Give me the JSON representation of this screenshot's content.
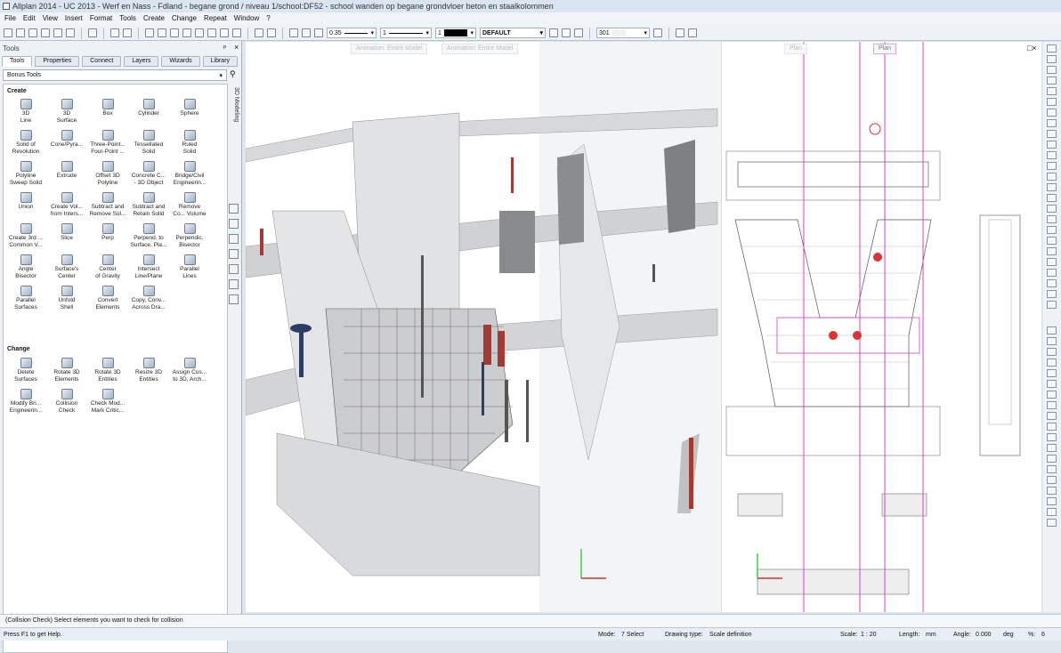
{
  "window": {
    "title": "Allplan 2014 - UC 2013 - Werf en Nass - Fdland - begane grond / niveau 1/school:DF52 - school wanden op begane grondvloer beton en staalkolommen"
  },
  "menu": [
    "File",
    "Edit",
    "View",
    "Insert",
    "Format",
    "Tools",
    "Create",
    "Change",
    "Repeat",
    "Window",
    "?"
  ],
  "toolbar": {
    "pen": "0.35",
    "line": "1",
    "color": "1",
    "layer": "DEFAULT",
    "format": "301"
  },
  "panel": {
    "title": "Tools",
    "pin": "ᵖ",
    "close": "×",
    "tabs": [
      "Tools",
      "Properties",
      "Connect",
      "Layers",
      "Wizards",
      "Library"
    ],
    "active_tab": "Tools",
    "palette": "Bonus Tools",
    "vertical_tab": "3D Modeling",
    "create_label": "Create",
    "create_tools": [
      [
        "3D",
        "Line"
      ],
      [
        "3D",
        "Surface"
      ],
      [
        "Box",
        ""
      ],
      [
        "Cylinder",
        ""
      ],
      [
        "Sphere",
        ""
      ],
      [
        "Solid of",
        "Revolution"
      ],
      [
        "Cone/Pyra...",
        ""
      ],
      [
        "Three-Point...",
        "Four-Point ..."
      ],
      [
        "Tessellated",
        "Solid"
      ],
      [
        "Ruled",
        "Solid"
      ],
      [
        "Polyline",
        "Sweep Solid"
      ],
      [
        "Extrude",
        ""
      ],
      [
        "Offset 3D",
        "Polyline"
      ],
      [
        "Concrete C...",
        "- 3D Object"
      ],
      [
        "Bridge/Civil",
        "Engineerin..."
      ],
      [
        "Union",
        ""
      ],
      [
        "Create Vol...",
        "from Inters..."
      ],
      [
        "Subtract and",
        "Remove Sol..."
      ],
      [
        "Subtract and",
        "Retain Solid"
      ],
      [
        "Remove",
        "Co... Volume"
      ],
      [
        "Create 3rd ...",
        "Common V..."
      ],
      [
        "Slice",
        ""
      ],
      [
        "Perp",
        ""
      ],
      [
        "Perpend. to",
        "Surface, Pla..."
      ],
      [
        "Perpendic.",
        "Bisector"
      ],
      [
        "Angle",
        "Bisector"
      ],
      [
        "Surface's",
        "Center"
      ],
      [
        "Center",
        "of Gravity"
      ],
      [
        "Intersect",
        "Line/Plane"
      ],
      [
        "Parallel",
        "Lines"
      ],
      [
        "Parallel",
        "Surfaces"
      ],
      [
        "Unfold",
        "Shell"
      ],
      [
        "Convert",
        "Elements"
      ],
      [
        "Copy, Conv...",
        "Across Dra..."
      ]
    ],
    "change_label": "Change",
    "change_tools": [
      [
        "Delete",
        "Surfaces"
      ],
      [
        "Rotate 3D",
        "Elements"
      ],
      [
        "Rotate 3D",
        "Entities"
      ],
      [
        "Resize 3D",
        "Entities"
      ],
      [
        "Assign Cus...",
        "to 3D, Arch..."
      ],
      [
        "Modify Bri...",
        "Engineerin..."
      ],
      [
        "Collision",
        "Check"
      ],
      [
        "Check Mod...",
        "Mark Critic..."
      ]
    ]
  },
  "viewport": {
    "buttons": [
      "Animation: Entire Model",
      "Animation: Entire Model"
    ],
    "plan_tabs": [
      "Plan",
      "Plan"
    ]
  },
  "cmdline": "(Collision Check) Select elements you want to check for collision",
  "status": {
    "help": "Press F1 to get Help.",
    "mode_label": "Mode:",
    "mode": "7 Select",
    "drawing_type_label": "Drawing type:",
    "drawing_type": "Scale definition",
    "scale_label": "Scale:",
    "scale": "1 : 20",
    "length_label": "Length:",
    "length": "mm",
    "angle_label": "Angle:",
    "angle": "0.000",
    "angle_unit": "deg",
    "percent_label": "%:",
    "percent": "6"
  }
}
